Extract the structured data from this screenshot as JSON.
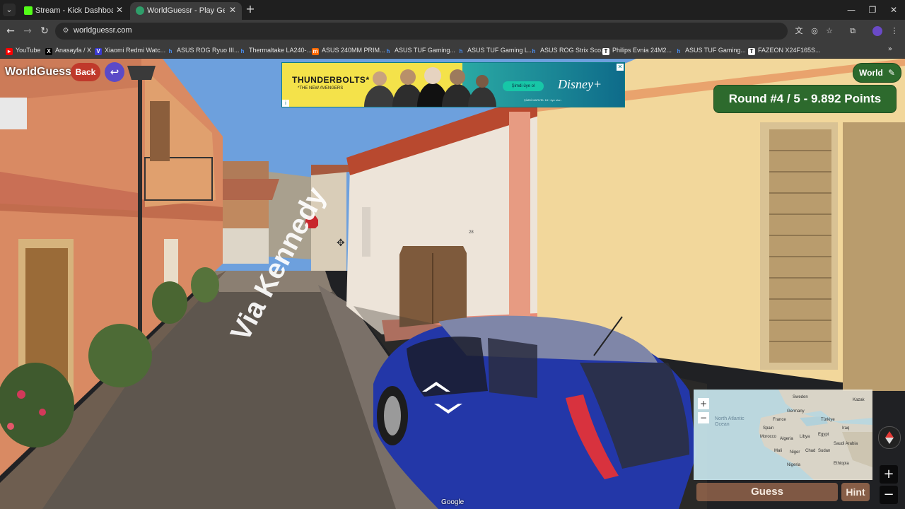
{
  "browser": {
    "tabs": [
      {
        "title": "Stream - Kick Dashboard",
        "active": false,
        "favicon_color": "#53fc18"
      },
      {
        "title": "WorldGuessr - Play Geoguessr",
        "active": true,
        "favicon_color": "#2f9e6a"
      }
    ],
    "url": "worldguessr.com",
    "bookmarks": [
      {
        "label": "YouTube",
        "icon": "youtube-icon"
      },
      {
        "label": "Anasayfa / X",
        "icon": "x-icon"
      },
      {
        "label": "Xiaomi Redmi Watc...",
        "icon": "v-icon"
      },
      {
        "label": "ASUS ROG Ryuo III...",
        "icon": "h-icon"
      },
      {
        "label": "Thermaltake LA240-...",
        "icon": "h-icon"
      },
      {
        "label": "ASUS 240MM PRIM...",
        "icon": "mi-icon"
      },
      {
        "label": "ASUS TUF Gaming...",
        "icon": "h-icon"
      },
      {
        "label": "ASUS TUF Gaming L...",
        "icon": "h-icon"
      },
      {
        "label": "ASUS ROG Strix Sco...",
        "icon": "h-icon"
      },
      {
        "label": "Philips Evnia 24M2...",
        "icon": "t-icon"
      },
      {
        "label": "ASUS TUF Gaming...",
        "icon": "h-icon"
      },
      {
        "label": "FAZEON X24F165S...",
        "icon": "t-icon"
      }
    ]
  },
  "game": {
    "logo": "WorldGuessr",
    "back_label": "Back",
    "world_label": "World",
    "round_status": "Round #4 / 5 - 9.892 Points",
    "guess_label": "Guess",
    "hint_label": "Hint",
    "google_label": "Google",
    "street_name": "Via Kennedy",
    "house_number": "28"
  },
  "ad": {
    "title": "THUNDERBOLTS*",
    "subtitle": "*THE NEW AVENGERS",
    "cta": "Şimdi üye ol",
    "brand": "Disney+",
    "fine_print": "ŞİMDİ MARVEL 18+ üye olun"
  },
  "minimap": {
    "labels": [
      "Sweden",
      "Kazak",
      "North Atlantic Ocean",
      "Germany",
      "France",
      "Türkiye",
      "Spain",
      "Iraq",
      "Morocco",
      "Algeria",
      "Libya",
      "Egypt",
      "Saudi Arabia",
      "Mali",
      "Niger",
      "Chad",
      "Sudan",
      "Nigeria",
      "Ethiopia"
    ],
    "land_color": "#e9e4d5",
    "water_color": "#c9e7ee"
  },
  "colors": {
    "green_panel": "#2d6a2d",
    "back_red": "#c0392b",
    "return_purple": "#5b4ac7"
  }
}
